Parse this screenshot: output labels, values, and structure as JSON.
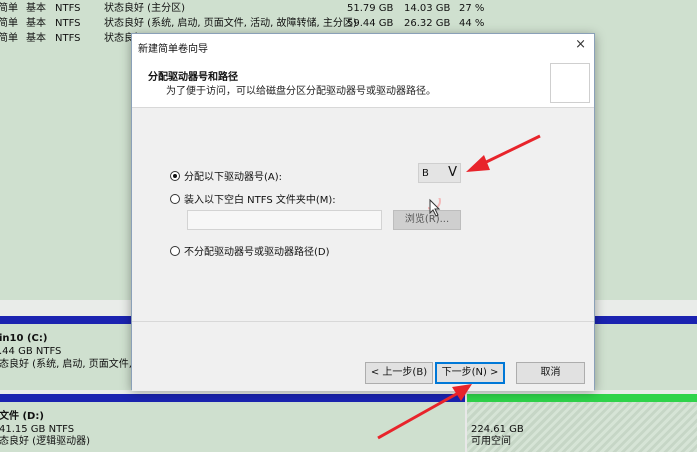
{
  "background_table": {
    "rows": [
      {
        "type": "简单",
        "kind": "基本",
        "fs": "NTFS",
        "status": "状态良好 (主分区)",
        "capacity": "51.79 GB",
        "free": "14.03 GB",
        "pct": "27 %"
      },
      {
        "type": "简单",
        "kind": "基本",
        "fs": "NTFS",
        "status": "状态良好 (系统, 启动, 页面文件, 活动, 故障转储, 主分区)",
        "capacity": "59.44 GB",
        "free": "26.32 GB",
        "pct": "44 %"
      },
      {
        "type": "简单",
        "kind": "基本",
        "fs": "NTFS",
        "status": "状态良好"
      }
    ]
  },
  "disk_map": {
    "c_volume": {
      "name": "in10  (C:)",
      "size": ".44 GB NTFS",
      "status": "态良好 (系统, 启动, 页面文件, 活"
    },
    "d_volume": {
      "name": "文件  (D:)",
      "size": "41.15 GB NTFS",
      "status": "态良好 (逻辑驱动器)"
    },
    "unallocated": {
      "size": "224.61 GB",
      "status": "可用空间"
    }
  },
  "dialog": {
    "title": "新建简单卷向导",
    "close_glyph": "×",
    "header_title": "分配驱动器号和路径",
    "header_subtitle": "为了便于访问，可以给磁盘分区分配驱动器号或驱动器路径。",
    "options": {
      "assign_letter": "分配以下驱动器号(A):",
      "mount_folder": "装入以下空白 NTFS 文件夹中(M):",
      "no_assign": "不分配驱动器号或驱动器路径(D)"
    },
    "drive_letter_value": "B",
    "drive_letter_chevron": "V",
    "browse_label": "浏览(R)...",
    "buttons": {
      "back": "< 上一步(B)",
      "next": "下一步(N) >",
      "cancel": "取消"
    }
  },
  "colors": {
    "arrow": "#e8242b",
    "disk_blue": "#1a23b0",
    "unallocated_green": "#2fd34a",
    "focus_blue": "#0078d7"
  }
}
